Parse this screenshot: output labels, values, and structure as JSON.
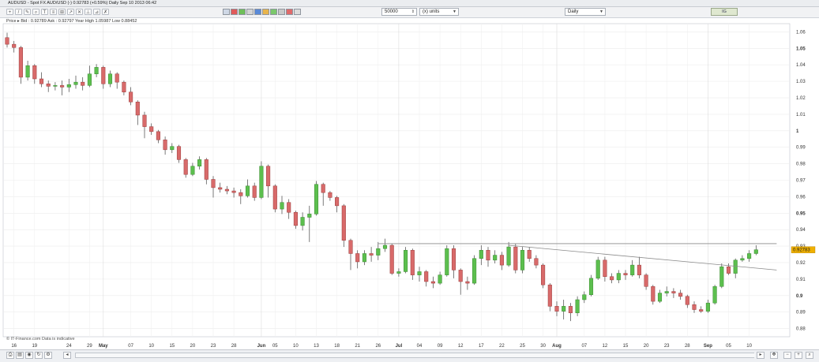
{
  "window": {
    "title": "AUDUSD - Spot FX AUD/USD (-)   0.92783 (+0.59%)   Daily  Sep 10 2013 06:42"
  },
  "toolbar": {
    "quantity_value": "50000",
    "units_value": "(x) units",
    "period_value": "Daily",
    "logo_label": "IG"
  },
  "info_line": "Price  ▸  Bid : 0.92789 Ask : 0.92797 Year High 1.05987 Low 0.88452",
  "footnote": "© IT-Finance.com  Data is indicative",
  "colors": {
    "up": "#5cbf4e",
    "down": "#d86a6a",
    "up_border": "#3a8a30",
    "down_border": "#9c3c3c",
    "price_badge": "#f0b000"
  },
  "chart_data": {
    "type": "candlestick",
    "title": "",
    "xlabel": "",
    "ylabel": "",
    "ylim": [
      0.875,
      1.065
    ],
    "y_ticks": [
      "1.06",
      "1.05",
      "1.04",
      "1.03",
      "1.02",
      "1.01",
      "1",
      "0.99",
      "0.98",
      "0.97",
      "0.96",
      "0.95",
      "0.94",
      "0.93",
      "0.92",
      "0.91",
      "0.9",
      "0.89",
      "0.88"
    ],
    "y_tick_values": [
      1.06,
      1.05,
      1.04,
      1.03,
      1.02,
      1.01,
      1.0,
      0.99,
      0.98,
      0.97,
      0.96,
      0.95,
      0.94,
      0.93,
      0.92,
      0.91,
      0.9,
      0.89,
      0.88
    ],
    "bold_ticks": [
      "1.05",
      "1",
      "0.95",
      "0.9"
    ],
    "x_labels": [
      {
        "label": "16",
        "i": 1
      },
      {
        "label": "19",
        "i": 4
      },
      {
        "label": "24",
        "i": 9
      },
      {
        "label": "29",
        "i": 12
      },
      {
        "label": "May",
        "i": 14,
        "bold": true
      },
      {
        "label": "07",
        "i": 18
      },
      {
        "label": "10",
        "i": 21
      },
      {
        "label": "15",
        "i": 24
      },
      {
        "label": "20",
        "i": 27
      },
      {
        "label": "23",
        "i": 30
      },
      {
        "label": "28",
        "i": 33
      },
      {
        "label": "Jun",
        "i": 37,
        "bold": true
      },
      {
        "label": "05",
        "i": 39
      },
      {
        "label": "10",
        "i": 42
      },
      {
        "label": "13",
        "i": 45
      },
      {
        "label": "18",
        "i": 48
      },
      {
        "label": "21",
        "i": 51
      },
      {
        "label": "26",
        "i": 54
      },
      {
        "label": "Jul",
        "i": 57,
        "bold": true
      },
      {
        "label": "04",
        "i": 60
      },
      {
        "label": "09",
        "i": 63
      },
      {
        "label": "12",
        "i": 66
      },
      {
        "label": "17",
        "i": 69
      },
      {
        "label": "22",
        "i": 72
      },
      {
        "label": "25",
        "i": 75
      },
      {
        "label": "30",
        "i": 78
      },
      {
        "label": "Aug",
        "i": 80,
        "bold": true
      },
      {
        "label": "07",
        "i": 84
      },
      {
        "label": "12",
        "i": 87
      },
      {
        "label": "15",
        "i": 90
      },
      {
        "label": "20",
        "i": 93
      },
      {
        "label": "23",
        "i": 96
      },
      {
        "label": "28",
        "i": 99
      },
      {
        "label": "Sep",
        "i": 102,
        "bold": true
      },
      {
        "label": "05",
        "i": 105
      },
      {
        "label": "10",
        "i": 108
      }
    ],
    "current_price": "0.92783",
    "candles": [
      [
        1.0565,
        1.0525,
        1.0595,
        1.0505
      ],
      [
        1.0525,
        1.0505,
        1.0545,
        1.0475
      ],
      [
        1.0505,
        1.0325,
        1.0515,
        1.0285
      ],
      [
        1.0325,
        1.0395,
        1.0425,
        1.0305
      ],
      [
        1.0395,
        1.0315,
        1.0405,
        1.0285
      ],
      [
        1.0315,
        1.0285,
        1.0355,
        1.0265
      ],
      [
        1.0285,
        1.027,
        1.0305,
        1.0235
      ],
      [
        1.027,
        1.0275,
        1.0295,
        1.0245
      ],
      [
        1.0275,
        1.0265,
        1.0305,
        1.0215
      ],
      [
        1.0265,
        1.028,
        1.0315,
        1.0235
      ],
      [
        1.028,
        1.0295,
        1.0335,
        1.0255
      ],
      [
        1.0295,
        1.0275,
        1.0325,
        1.0245
      ],
      [
        1.0275,
        1.0345,
        1.0395,
        1.0265
      ],
      [
        1.0345,
        1.0385,
        1.0405,
        1.0325
      ],
      [
        1.0385,
        1.0285,
        1.0395,
        1.0255
      ],
      [
        1.0285,
        1.0345,
        1.0365,
        1.0265
      ],
      [
        1.0345,
        1.0295,
        1.0355,
        1.0255
      ],
      [
        1.0295,
        1.0235,
        1.0305,
        1.0215
      ],
      [
        1.0235,
        1.0175,
        1.0265,
        1.0155
      ],
      [
        1.0175,
        1.0095,
        1.0185,
        1.0035
      ],
      [
        1.0095,
        1.0025,
        1.0115,
        0.9955
      ],
      [
        1.0025,
        0.9995,
        1.0045,
        0.9975
      ],
      [
        0.9995,
        0.9945,
        1.0005,
        0.9925
      ],
      [
        0.9945,
        0.9885,
        0.9965,
        0.9855
      ],
      [
        0.9885,
        0.9905,
        0.9925,
        0.9865
      ],
      [
        0.9905,
        0.9825,
        0.9915,
        0.9805
      ],
      [
        0.9825,
        0.9735,
        0.9835,
        0.9715
      ],
      [
        0.9735,
        0.9785,
        0.9805,
        0.9725
      ],
      [
        0.9785,
        0.9825,
        0.9845,
        0.9765
      ],
      [
        0.9825,
        0.9705,
        0.9835,
        0.9675
      ],
      [
        0.9705,
        0.9655,
        0.9725,
        0.9595
      ],
      [
        0.9655,
        0.9645,
        0.9685,
        0.9625
      ],
      [
        0.9645,
        0.9635,
        0.9665,
        0.9615
      ],
      [
        0.9635,
        0.9625,
        0.9655,
        0.9595
      ],
      [
        0.9625,
        0.9605,
        0.9645,
        0.9555
      ],
      [
        0.9605,
        0.9665,
        0.9705,
        0.9595
      ],
      [
        0.9665,
        0.9595,
        0.9685,
        0.9575
      ],
      [
        0.9595,
        0.9785,
        0.9815,
        0.9585
      ],
      [
        0.9785,
        0.9665,
        0.9795,
        0.9595
      ],
      [
        0.9665,
        0.9525,
        0.9675,
        0.9505
      ],
      [
        0.9525,
        0.9565,
        0.9605,
        0.9495
      ],
      [
        0.9565,
        0.9505,
        0.9585,
        0.9465
      ],
      [
        0.9505,
        0.9425,
        0.9515,
        0.9405
      ],
      [
        0.9425,
        0.9475,
        0.9505,
        0.9395
      ],
      [
        0.9475,
        0.9495,
        0.9545,
        0.9325
      ],
      [
        0.9495,
        0.9675,
        0.9695,
        0.9485
      ],
      [
        0.9675,
        0.9625,
        0.9685,
        0.9545
      ],
      [
        0.9625,
        0.9595,
        0.9635,
        0.9575
      ],
      [
        0.9595,
        0.9545,
        0.9605,
        0.9505
      ],
      [
        0.9545,
        0.9335,
        0.9555,
        0.9295
      ],
      [
        0.9335,
        0.9255,
        0.9345,
        0.9155
      ],
      [
        0.9255,
        0.9205,
        0.9275,
        0.9165
      ],
      [
        0.9205,
        0.9255,
        0.9275,
        0.9185
      ],
      [
        0.9255,
        0.9245,
        0.9295,
        0.9205
      ],
      [
        0.9245,
        0.9285,
        0.9325,
        0.9215
      ],
      [
        0.9285,
        0.9305,
        0.9345,
        0.9265
      ],
      [
        0.9305,
        0.9135,
        0.9315,
        0.9125
      ],
      [
        0.9135,
        0.9145,
        0.9165,
        0.9115
      ],
      [
        0.9145,
        0.9275,
        0.9295,
        0.9135
      ],
      [
        0.9275,
        0.9125,
        0.9285,
        0.9095
      ],
      [
        0.9125,
        0.9145,
        0.9175,
        0.9085
      ],
      [
        0.9145,
        0.9085,
        0.9155,
        0.9055
      ],
      [
        0.9085,
        0.9075,
        0.9115,
        0.9045
      ],
      [
        0.9075,
        0.9125,
        0.9145,
        0.9065
      ],
      [
        0.9125,
        0.9285,
        0.9305,
        0.9115
      ],
      [
        0.9285,
        0.9155,
        0.9305,
        0.9105
      ],
      [
        0.9155,
        0.9085,
        0.9165,
        0.9005
      ],
      [
        0.9085,
        0.9075,
        0.9115,
        0.9035
      ],
      [
        0.9075,
        0.9225,
        0.9245,
        0.9065
      ],
      [
        0.9225,
        0.9275,
        0.9305,
        0.9185
      ],
      [
        0.9275,
        0.9215,
        0.9295,
        0.9175
      ],
      [
        0.9215,
        0.9245,
        0.9275,
        0.9195
      ],
      [
        0.9245,
        0.9185,
        0.9265,
        0.9155
      ],
      [
        0.9185,
        0.9295,
        0.9325,
        0.9175
      ],
      [
        0.9295,
        0.9155,
        0.9315,
        0.9135
      ],
      [
        0.9155,
        0.9275,
        0.9295,
        0.9135
      ],
      [
        0.9275,
        0.9225,
        0.9295,
        0.9205
      ],
      [
        0.9225,
        0.9185,
        0.9245,
        0.9165
      ],
      [
        0.9185,
        0.9065,
        0.9195,
        0.9045
      ],
      [
        0.9065,
        0.8935,
        0.9075,
        0.8905
      ],
      [
        0.8935,
        0.8905,
        0.8965,
        0.8875
      ],
      [
        0.8905,
        0.8935,
        0.8975,
        0.8855
      ],
      [
        0.8935,
        0.8895,
        0.8955,
        0.8845
      ],
      [
        0.8895,
        0.8975,
        0.8995,
        0.8875
      ],
      [
        0.8975,
        0.9005,
        0.9025,
        0.8955
      ],
      [
        0.9005,
        0.9105,
        0.9125,
        0.8995
      ],
      [
        0.9105,
        0.9215,
        0.9235,
        0.9095
      ],
      [
        0.9215,
        0.9115,
        0.9235,
        0.9085
      ],
      [
        0.9115,
        0.9095,
        0.9135,
        0.9075
      ],
      [
        0.9095,
        0.9135,
        0.9155,
        0.9075
      ],
      [
        0.9135,
        0.9125,
        0.9155,
        0.9095
      ],
      [
        0.9125,
        0.9185,
        0.9215,
        0.9115
      ],
      [
        0.9185,
        0.9125,
        0.9235,
        0.9105
      ],
      [
        0.9125,
        0.9055,
        0.9135,
        0.9035
      ],
      [
        0.9055,
        0.8965,
        0.9065,
        0.8945
      ],
      [
        0.8965,
        0.9015,
        0.9035,
        0.8955
      ],
      [
        0.9015,
        0.9025,
        0.9055,
        0.8995
      ],
      [
        0.9025,
        0.9015,
        0.9045,
        0.8985
      ],
      [
        0.9015,
        0.8995,
        0.9035,
        0.8975
      ],
      [
        0.8995,
        0.8945,
        0.9005,
        0.8925
      ],
      [
        0.8945,
        0.8915,
        0.8965,
        0.8895
      ],
      [
        0.8915,
        0.8905,
        0.8935,
        0.8895
      ],
      [
        0.8905,
        0.8955,
        0.8975,
        0.8895
      ],
      [
        0.8955,
        0.9055,
        0.9065,
        0.8945
      ],
      [
        0.9055,
        0.9175,
        0.9195,
        0.9045
      ],
      [
        0.9175,
        0.9135,
        0.9195,
        0.9125
      ],
      [
        0.9135,
        0.9215,
        0.9225,
        0.9105
      ],
      [
        0.9215,
        0.9225,
        0.9245,
        0.9205
      ],
      [
        0.9225,
        0.9255,
        0.9275,
        0.9205
      ],
      [
        0.9255,
        0.9278,
        0.9305,
        0.9245
      ]
    ],
    "trendlines": [
      {
        "from_i": 54,
        "from_y": 0.9315,
        "to_i": 112,
        "to_y": 0.9315
      },
      {
        "from_i": 73,
        "from_y": 0.9305,
        "to_i": 112,
        "to_y": 0.9155
      }
    ]
  }
}
